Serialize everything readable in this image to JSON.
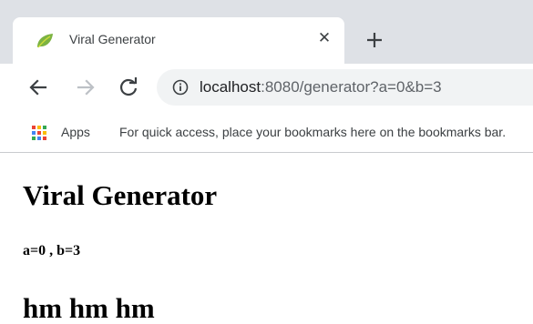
{
  "browser": {
    "tab": {
      "title": "Viral Generator",
      "favicon": "leaf-icon",
      "close_glyph": "✕"
    },
    "new_tab_icon": "plus-icon",
    "nav": {
      "back_icon": "arrow-left-icon",
      "forward_icon": "arrow-right-icon",
      "reload_icon": "reload-icon"
    },
    "omnibox": {
      "info_icon": "info-icon",
      "url_host": "localhost",
      "url_rest": ":8080/generator?a=0&b=3"
    },
    "bookmarks_bar": {
      "apps_label": "Apps",
      "hint": "For quick access, place your bookmarks here on the bookmarks bar."
    }
  },
  "page": {
    "title": "Viral Generator",
    "params": "a=0 , b=3",
    "message": "hm hm hm"
  },
  "colors": {
    "tabstrip_bg": "#dee1e6",
    "omnibox_bg": "#f1f3f4",
    "favicon_green": "#7cb342"
  }
}
